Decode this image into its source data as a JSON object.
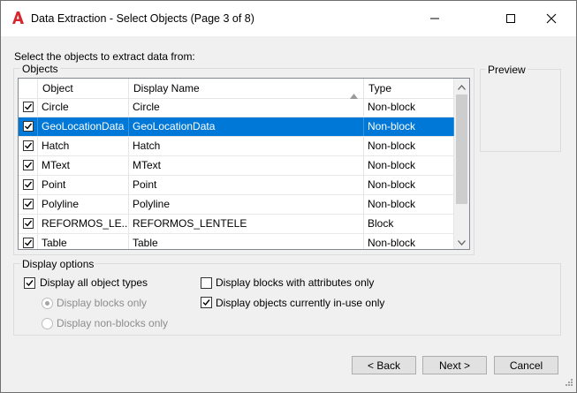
{
  "window": {
    "title": "Data Extraction - Select Objects (Page 3 of 8)",
    "app_icon": "autocad-logo-icon",
    "controls": [
      "minimize-icon",
      "maximize-icon",
      "close-icon"
    ]
  },
  "prompt": "Select the objects to extract data from:",
  "objects_group": {
    "label": "Objects",
    "columns": [
      "Object",
      "Display Name",
      "Type"
    ],
    "sort_column": "Display Name",
    "rows": [
      {
        "object": "Circle",
        "display_name": "Circle",
        "type": "Non-block",
        "checked": true,
        "selected": false
      },
      {
        "object": "GeoLocationData",
        "display_name": "GeoLocationData",
        "type": "Non-block",
        "checked": true,
        "selected": true
      },
      {
        "object": "Hatch",
        "display_name": "Hatch",
        "type": "Non-block",
        "checked": true,
        "selected": false
      },
      {
        "object": "MText",
        "display_name": "MText",
        "type": "Non-block",
        "checked": true,
        "selected": false
      },
      {
        "object": "Point",
        "display_name": "Point",
        "type": "Non-block",
        "checked": true,
        "selected": false
      },
      {
        "object": "Polyline",
        "display_name": "Polyline",
        "type": "Non-block",
        "checked": true,
        "selected": false
      },
      {
        "object": "REFORMOS_LE...",
        "display_name": "REFORMOS_LENTELE",
        "type": "Block",
        "checked": true,
        "selected": false
      },
      {
        "object": "Table",
        "display_name": "Table",
        "type": "Non-block",
        "checked": true,
        "selected": false
      }
    ]
  },
  "preview": {
    "label": "Preview"
  },
  "display_options": {
    "label": "Display options",
    "display_all_types": {
      "label": "Display all object types",
      "checked": true
    },
    "blocks_only": {
      "label": "Display blocks only",
      "selected": true,
      "enabled": false
    },
    "non_blocks_only": {
      "label": "Display non-blocks only",
      "selected": false,
      "enabled": false
    },
    "blocks_with_attributes": {
      "label": "Display blocks with attributes only",
      "checked": false
    },
    "objects_in_use": {
      "label": "Display objects currently in-use only",
      "checked": true
    }
  },
  "buttons": {
    "back": "< Back",
    "next": "Next >",
    "cancel": "Cancel"
  }
}
